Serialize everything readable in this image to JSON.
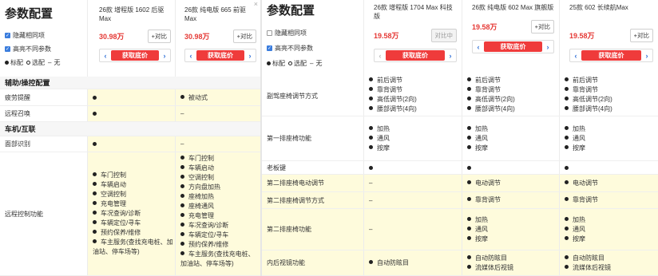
{
  "left": {
    "title": "参数配置",
    "options": [
      {
        "label": "隐藏相同项",
        "checked": true
      },
      {
        "label": "高亮不同参数",
        "checked": true
      }
    ],
    "legend": {
      "standard": "标配",
      "optional": "选配",
      "none_dash": "–",
      "none": "无"
    },
    "cars": [
      {
        "name": "26款 增程版 1602 后驱 Max",
        "price": "30.98万",
        "compare": "+对比",
        "get_price": "获取底价"
      },
      {
        "name": "26款 纯电版 665 前驱 Max",
        "price": "30.98万",
        "compare": "+对比",
        "get_price": "获取底价"
      }
    ],
    "sections": [
      {
        "title": "辅助/操控配置",
        "rows": [
          {
            "label": "疲劳提醒",
            "c1": [
              "●"
            ],
            "c2": [
              "● 被动式"
            ],
            "highlight": true
          },
          {
            "label": "远程召唤",
            "c1": [
              "●"
            ],
            "c2": [
              "–"
            ],
            "highlight": true
          }
        ]
      },
      {
        "title": "车机/互联",
        "rows": [
          {
            "label": "面部识别",
            "c1": [
              "●"
            ],
            "c2": [
              "–"
            ],
            "highlight": true
          },
          {
            "label": "远程控制功能",
            "c1": [
              "车门控制",
              "车辆启动",
              "空调控制",
              "充电管理",
              "车况查询/诊断",
              "车辆定位/寻车",
              "预约保养/维修",
              "车主服务(查找充电桩、加油站、停车场等)"
            ],
            "c2": [
              "车门控制",
              "车辆启动",
              "空调控制",
              "方向盘加热",
              "座椅加热",
              "座椅通风",
              "充电管理",
              "车况查询/诊断",
              "车辆定位/寻车",
              "预约保养/维修",
              "车主服务(查找充电桩、加油站、停车场等)"
            ],
            "highlight": true
          }
        ]
      }
    ]
  },
  "right": {
    "title": "参数配置",
    "options": [
      {
        "label": "隐藏相同项",
        "checked": false
      },
      {
        "label": "高亮不同参数",
        "checked": true
      }
    ],
    "legend": {
      "standard": "标配",
      "optional": "选配",
      "none_dash": "–",
      "none": "无"
    },
    "cars": [
      {
        "name": "26款 增程版 1704 Max 科技版",
        "price": "19.58万",
        "compare": "对比中",
        "get_price": "获取底价"
      },
      {
        "name": "26款 纯电版 602 Max 旗舰版",
        "price": "19.58万",
        "compare": "+对比",
        "get_price": "获取底价"
      },
      {
        "name": "25款 602 长续航Max",
        "price": "19.58万",
        "compare": "+对比",
        "get_price": "获取底价"
      }
    ],
    "rows": [
      {
        "label": "副驾座椅调节方式",
        "cells": [
          [
            "前后调节",
            "靠背调节",
            "高低调节(2向)",
            "腰部调节(4向)"
          ],
          [
            "前后调节",
            "靠背调节",
            "高低调节(2向)",
            "腰部调节(4向)"
          ],
          [
            "前后调节",
            "靠背调节",
            "高低调节(2向)",
            "腰部调节(4向)"
          ]
        ],
        "highlight": false
      },
      {
        "label": "第一排座椅功能",
        "cells": [
          [
            "加热",
            "通风",
            "按摩"
          ],
          [
            "加热",
            "通风",
            "按摩"
          ],
          [
            "加热",
            "通风",
            "按摩"
          ]
        ],
        "highlight": false
      },
      {
        "label": "老板键",
        "cells": [
          [
            "●"
          ],
          [
            "●"
          ],
          [
            "●"
          ]
        ],
        "highlight": false
      },
      {
        "label": "第二排座椅电动调节",
        "cells": [
          [
            "–"
          ],
          [
            "电动调节"
          ],
          [
            "电动调节"
          ]
        ],
        "highlight": true
      },
      {
        "label": "第二排座椅调节方式",
        "cells": [
          [
            "–"
          ],
          [
            "靠背调节"
          ],
          [
            "靠背调节"
          ]
        ],
        "highlight": true
      },
      {
        "label": "第二排座椅功能",
        "cells": [
          [
            "–"
          ],
          [
            "加热",
            "通风",
            "按摩"
          ],
          [
            "加热",
            "通风",
            "按摩"
          ]
        ],
        "highlight": true
      },
      {
        "label": "内后视镜功能",
        "cells": [
          [
            "自动防眩目"
          ],
          [
            "自动防眩目",
            "流媒体后视镜"
          ],
          [
            "自动防眩目",
            "流媒体后视镜"
          ]
        ],
        "highlight": true
      }
    ]
  }
}
